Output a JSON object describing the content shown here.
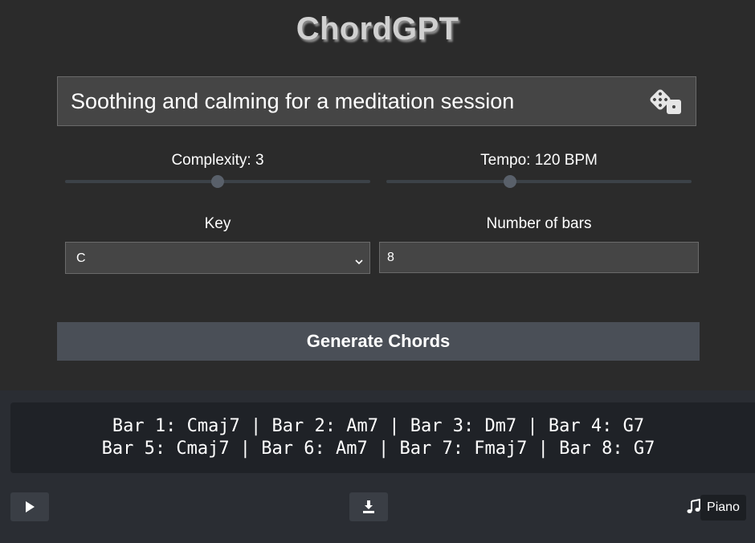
{
  "app": {
    "title": "ChordGPT"
  },
  "prompt": {
    "text": "Soothing and calming for a meditation session",
    "randomize_icon": "dice-icon"
  },
  "complexity": {
    "label": "Complexity: 3",
    "value": 3
  },
  "tempo": {
    "label": "Tempo: 120 BPM",
    "value": 120
  },
  "key": {
    "label": "Key",
    "selected": "C"
  },
  "bars": {
    "label": "Number of bars",
    "value": "8"
  },
  "generate": {
    "label": "Generate Chords"
  },
  "output": {
    "lines": [
      "Bar 1: Cmaj7 | Bar 2: Am7 | Bar 3: Dm7 | Bar 4: G7",
      "Bar 5: Cmaj7 | Bar 6: Am7 | Bar 7: Fmaj7 | Bar 8: G7"
    ]
  },
  "controls": {
    "play_icon": "play-icon",
    "download_icon": "download-icon",
    "instrument_icon": "music-note-icon",
    "instrument_label": "Piano"
  },
  "colors": {
    "background": "#2b2b2b",
    "panel": "#454545",
    "button": "#4a4f57",
    "bottom": "#2a2d33"
  }
}
